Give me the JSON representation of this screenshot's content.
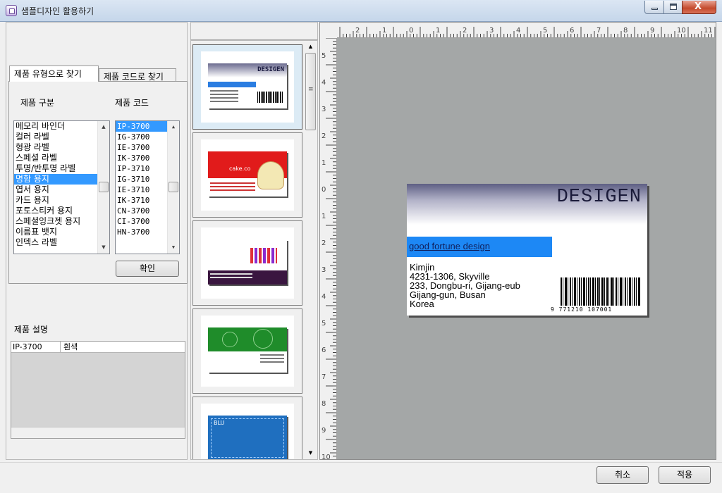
{
  "window": {
    "title": "샘플디자인 활용하기",
    "close_glyph": "X"
  },
  "search": {
    "tabs": [
      {
        "label": "제품 유형으로 찾기",
        "active": true
      },
      {
        "label": "제품 코드로 찾기",
        "active": false
      }
    ],
    "category_label": "제품 구분",
    "code_label": "제품 코드",
    "categories": [
      "메모리 바인더",
      "컬러 라벨",
      "형광 라벨",
      "스페셜 라벨",
      "투명/반투명 라벨",
      "명함 용지",
      "엽서 용지",
      "카드 용지",
      "포토스티커 용지",
      "스페셜잉크젯 용지",
      "이름표 뱃지",
      "인덱스 라벨"
    ],
    "selected_category": "명함 용지",
    "codes": [
      "IP-3700",
      "IG-3700",
      "IE-3700",
      "IK-3700",
      "IP-3710",
      "IG-3710",
      "IE-3710",
      "IK-3710",
      "CN-3700",
      "CI-3700",
      "HN-3700"
    ],
    "selected_code": "IP-3700",
    "confirm_label": "확인"
  },
  "description": {
    "title": "제품 설명",
    "code": "IP-3700",
    "color": "흰색"
  },
  "thumbnails": [
    {
      "name": "design-1",
      "text": "DESIGEN",
      "selected": true
    },
    {
      "name": "design-2",
      "text": "cake.co",
      "selected": false
    },
    {
      "name": "design-3",
      "text": "",
      "selected": false
    },
    {
      "name": "design-4",
      "text": "",
      "selected": false
    },
    {
      "name": "design-5",
      "text": "BLU",
      "selected": false
    }
  ],
  "ruler": {
    "top": [
      "2",
      "1",
      "0",
      "1",
      "2",
      "3",
      "4",
      "5",
      "6",
      "7",
      "8",
      "9",
      "10",
      "11"
    ],
    "left": [
      "5",
      "4",
      "3",
      "2",
      "1",
      "0",
      "1",
      "2",
      "3",
      "4",
      "5",
      "6",
      "7",
      "8",
      "9",
      "10"
    ]
  },
  "card": {
    "title": "DESIGEN",
    "slogan": "good fortune design",
    "name": "Kimjin",
    "address": [
      "4231-1306, Skyville",
      "233, Dongbu-ri, Gijang-eub",
      "Gijang-gun, Busan",
      "Korea"
    ],
    "barcode_number": "9 771210 107001"
  },
  "footer": {
    "cancel_label": "취소",
    "apply_label": "적용"
  }
}
